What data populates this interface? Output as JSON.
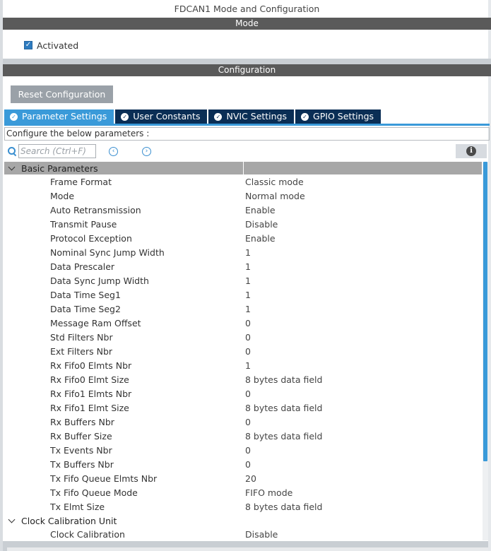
{
  "window": {
    "title": "FDCAN1 Mode and Configuration"
  },
  "mode_section": {
    "title": "Mode",
    "activated_label": "Activated",
    "activated_checked": true
  },
  "config_section": {
    "title": "Configuration",
    "reset_button": "Reset Configuration",
    "tabs": [
      {
        "label": "Parameter Settings",
        "active": true
      },
      {
        "label": "User Constants",
        "active": false
      },
      {
        "label": "NVIC Settings",
        "active": false
      },
      {
        "label": "GPIO Settings",
        "active": false
      }
    ],
    "configure_label": "Configure the below parameters :",
    "search": {
      "placeholder": "Search (Ctrl+F)"
    }
  },
  "parameters": {
    "groups": [
      {
        "name": "Basic Parameters",
        "rows": [
          {
            "name": "Frame Format",
            "value": "Classic mode"
          },
          {
            "name": "Mode",
            "value": "Normal mode"
          },
          {
            "name": "Auto Retransmission",
            "value": "Enable"
          },
          {
            "name": "Transmit Pause",
            "value": "Disable"
          },
          {
            "name": "Protocol Exception",
            "value": "Enable"
          },
          {
            "name": "Nominal Sync Jump Width",
            "value": "1"
          },
          {
            "name": "Data Prescaler",
            "value": "1"
          },
          {
            "name": "Data Sync Jump Width",
            "value": "1"
          },
          {
            "name": "Data Time Seg1",
            "value": "1"
          },
          {
            "name": "Data Time Seg2",
            "value": "1"
          },
          {
            "name": "Message Ram Offset",
            "value": "0"
          },
          {
            "name": "Std Filters Nbr",
            "value": "0"
          },
          {
            "name": "Ext Filters Nbr",
            "value": "0"
          },
          {
            "name": "Rx Fifo0 Elmts Nbr",
            "value": "1"
          },
          {
            "name": "Rx Fifo0 Elmt Size",
            "value": "8 bytes data field"
          },
          {
            "name": "Rx Fifo1 Elmts Nbr",
            "value": "0"
          },
          {
            "name": "Rx Fifo1 Elmt Size",
            "value": "8 bytes data field"
          },
          {
            "name": "Rx Buffers Nbr",
            "value": "0"
          },
          {
            "name": "Rx Buffer Size",
            "value": "8 bytes data field"
          },
          {
            "name": "Tx Events Nbr",
            "value": "0"
          },
          {
            "name": "Tx Buffers Nbr",
            "value": "0"
          },
          {
            "name": "Tx Fifo Queue Elmts Nbr",
            "value": "20"
          },
          {
            "name": "Tx Fifo Queue Mode",
            "value": "FIFO mode"
          },
          {
            "name": "Tx Elmt Size",
            "value": "8 bytes data field"
          }
        ]
      },
      {
        "name": "Clock Calibration Unit",
        "rows": [
          {
            "name": "Clock Calibration",
            "value": "Disable"
          }
        ]
      }
    ]
  },
  "colors": {
    "section_bar": "#5a5a5a",
    "tab_active": "#3a9ad9",
    "tab_inactive": "#0a2e55",
    "group_header": "#a7a7a7",
    "accent": "#2e7bbf"
  },
  "icons": {
    "checkbox": "check-icon",
    "tab": "check-circle-icon",
    "search": "search-icon",
    "prev": "chevron-left-circle-icon",
    "next": "chevron-right-circle-icon",
    "info": "info-icon",
    "group": "chevron-down-icon"
  }
}
